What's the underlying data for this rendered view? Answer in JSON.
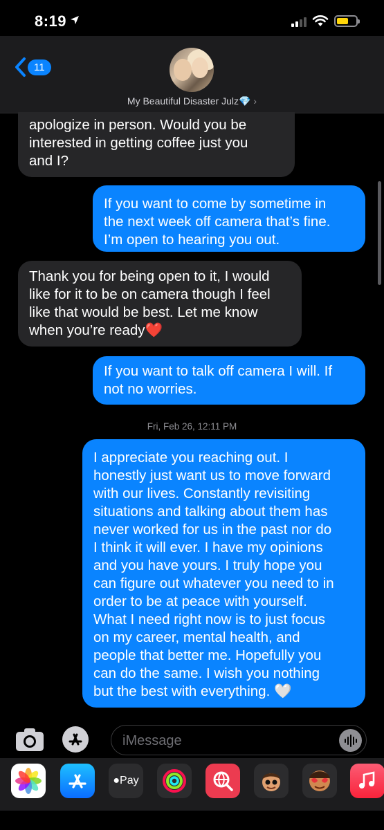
{
  "status_bar": {
    "time": "8:19"
  },
  "header": {
    "back_count": "11",
    "contact_name": "My Beautiful Disaster Julz💎"
  },
  "messages": [
    {
      "type": "received",
      "lines": [
        "apologize in person. Would you be",
        "interested in getting coffee just you",
        "and I?"
      ]
    },
    {
      "type": "sent",
      "lines": [
        "If you want to come by sometime in",
        "the next week off camera that’s fine.",
        "I’m open to hearing you out."
      ]
    },
    {
      "type": "received",
      "lines": [
        "Thank you for being open to it, I would",
        "like for it to be on camera though I feel",
        "like that would be best. Let me know",
        "when you’re ready❤️"
      ]
    },
    {
      "type": "sent",
      "lines": [
        "If you want to talk off camera I will. If",
        "not no worries."
      ]
    },
    {
      "type": "sent",
      "lines": [
        "I appreciate you reaching out. I",
        "honestly just want us to move forward",
        "with our lives. Constantly revisiting",
        "situations and talking about them has",
        "never worked for us in the past nor do",
        "I think it will ever. I have my opinions",
        "and you have yours. I truly hope you",
        "can figure out whatever you need to in",
        "order to be at peace with yourself.",
        "What I need right now is to just focus",
        "on my career, mental health, and",
        "people that better me. Hopefully you",
        "can do the same. I wish you nothing",
        "but the best with everything. 🤍"
      ]
    }
  ],
  "timestamp": {
    "day": "Fri, Feb 26,",
    "time": "12:11 PM"
  },
  "compose": {
    "placeholder": "iMessage"
  },
  "app_drawer": {
    "apple_pay_label": "Pay",
    "apps": [
      "photos-icon",
      "app-store-icon",
      "apple-pay-icon",
      "activity-icon",
      "web-search-icon",
      "memoji-icon",
      "memoji-stickers-icon",
      "music-icon"
    ]
  },
  "colors": {
    "sent": "#0a84ff",
    "received": "#262628",
    "background": "#000000"
  }
}
